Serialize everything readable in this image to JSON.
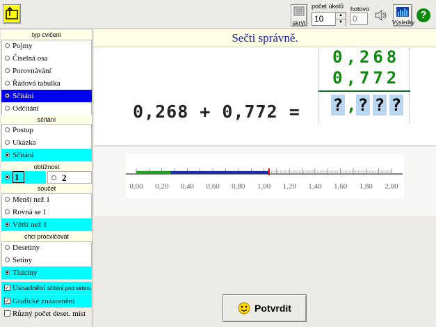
{
  "toolbar": {
    "hide_label": "skrýt",
    "task_count_label": "počet úkolů",
    "task_count_value": "10",
    "done_label": "hotovo",
    "done_value": "0",
    "results_label": "Výsledky"
  },
  "sidebar": {
    "type_header": "typ cvičení",
    "type_items": [
      "Pojmy",
      "Číselná osa",
      "Porovnávání",
      "Řádová tabulka",
      "Sčítání",
      "Odčítání"
    ],
    "addition_header": "sčítání",
    "addition_items": [
      "Postup",
      "Ukázka",
      "Sčítání"
    ],
    "difficulty_header": "obtížnost",
    "difficulty_items": [
      "1",
      "2"
    ],
    "sum_header": "součet",
    "sum_items": [
      "Menší než 1",
      "Rovná se 1",
      "Větší než 1"
    ],
    "practice_header": "chci procvičovat",
    "practice_items": [
      "Desetiny",
      "Setiny",
      "Tisíciny"
    ],
    "checks": {
      "easier_label": "Usnadnění",
      "easier_sub": "sčítání pod sebou",
      "graphic_label": "Grafické znázornění",
      "different_label": "Různý počet deset. míst"
    }
  },
  "task": {
    "title": "Sečti správně.",
    "expression": "0,268 + 0,772 =",
    "column_top": "0,268",
    "column_middle": "0,772",
    "answer_placeholder": [
      "?",
      ",",
      "?",
      "?",
      "?"
    ]
  },
  "scale": {
    "ticks": [
      "0,00",
      "0,20",
      "0,40",
      "0,60",
      "0,80",
      "1,00",
      "1,20",
      "1,40",
      "1,60",
      "1,80",
      "2,00"
    ],
    "green_value": 0.268,
    "blue_value": 0.772,
    "max": 2.0
  },
  "confirm": {
    "label": "Potvrdit"
  },
  "colors": {
    "selected_blue": "#0000ee",
    "selected_cyan": "#00ffff",
    "green_digits": "#0e8a0e",
    "title_blue": "#1a1aa8"
  }
}
